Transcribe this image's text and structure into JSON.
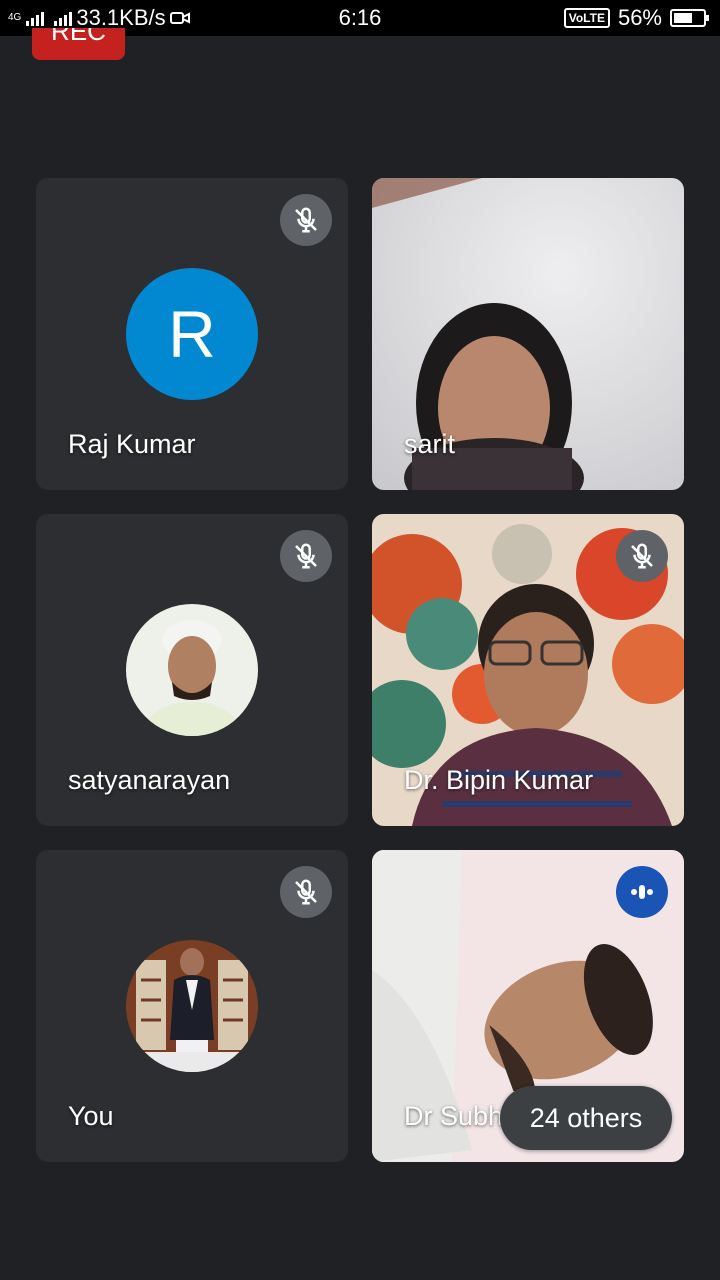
{
  "status_bar": {
    "network": "4G",
    "speed": "33.1KB/s",
    "time": "6:16",
    "volte": "VoLTE",
    "battery": "56%"
  },
  "recording_badge": "REC",
  "participants": [
    {
      "name": "Raj Kumar",
      "avatar_letter": "R",
      "avatar_color": "#0288d1",
      "muted": true
    },
    {
      "name": "sarit",
      "muted": false
    },
    {
      "name": "satyanarayan",
      "muted": true
    },
    {
      "name": "Dr. Bipin Kumar",
      "muted": true
    },
    {
      "name": "You",
      "muted": true
    },
    {
      "name": "Dr Subh",
      "speaking": true
    }
  ],
  "others_chip": "24 others",
  "icons": {
    "mute": "mic-off-icon",
    "speaking": "speaking-icon",
    "video": "camera-icon"
  },
  "colors": {
    "background": "#202124",
    "tile": "#2d2e31",
    "rec": "#c5221f",
    "speaking": "#1a55b5"
  }
}
